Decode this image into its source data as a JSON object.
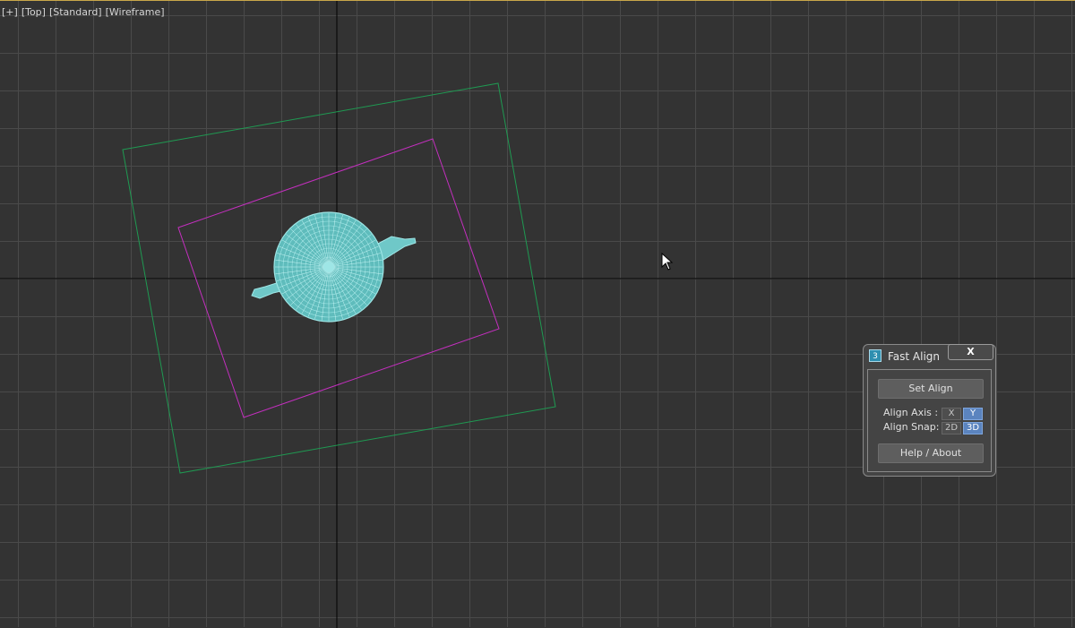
{
  "viewport": {
    "labels": [
      "[+]",
      "[Top]",
      "[Standard]",
      "[Wireframe]"
    ],
    "colors": {
      "background": "#333333",
      "grid": "#4a4a4a",
      "axis": "#000000",
      "outer_rect": "#1f9a52",
      "inner_rect": "#c42fbf",
      "teapot": "#9ee6e6"
    }
  },
  "dialog": {
    "icon_text": "3",
    "title": "Fast Align",
    "close_label": "X",
    "set_align_label": "Set Align",
    "align_axis_label": "Align Axis :",
    "align_axis_options": [
      "X",
      "Y"
    ],
    "align_axis_selected": "Y",
    "align_snap_label": "Align Snap:",
    "align_snap_options": [
      "2D",
      "3D"
    ],
    "align_snap_selected": "3D",
    "help_label": "Help / About"
  }
}
